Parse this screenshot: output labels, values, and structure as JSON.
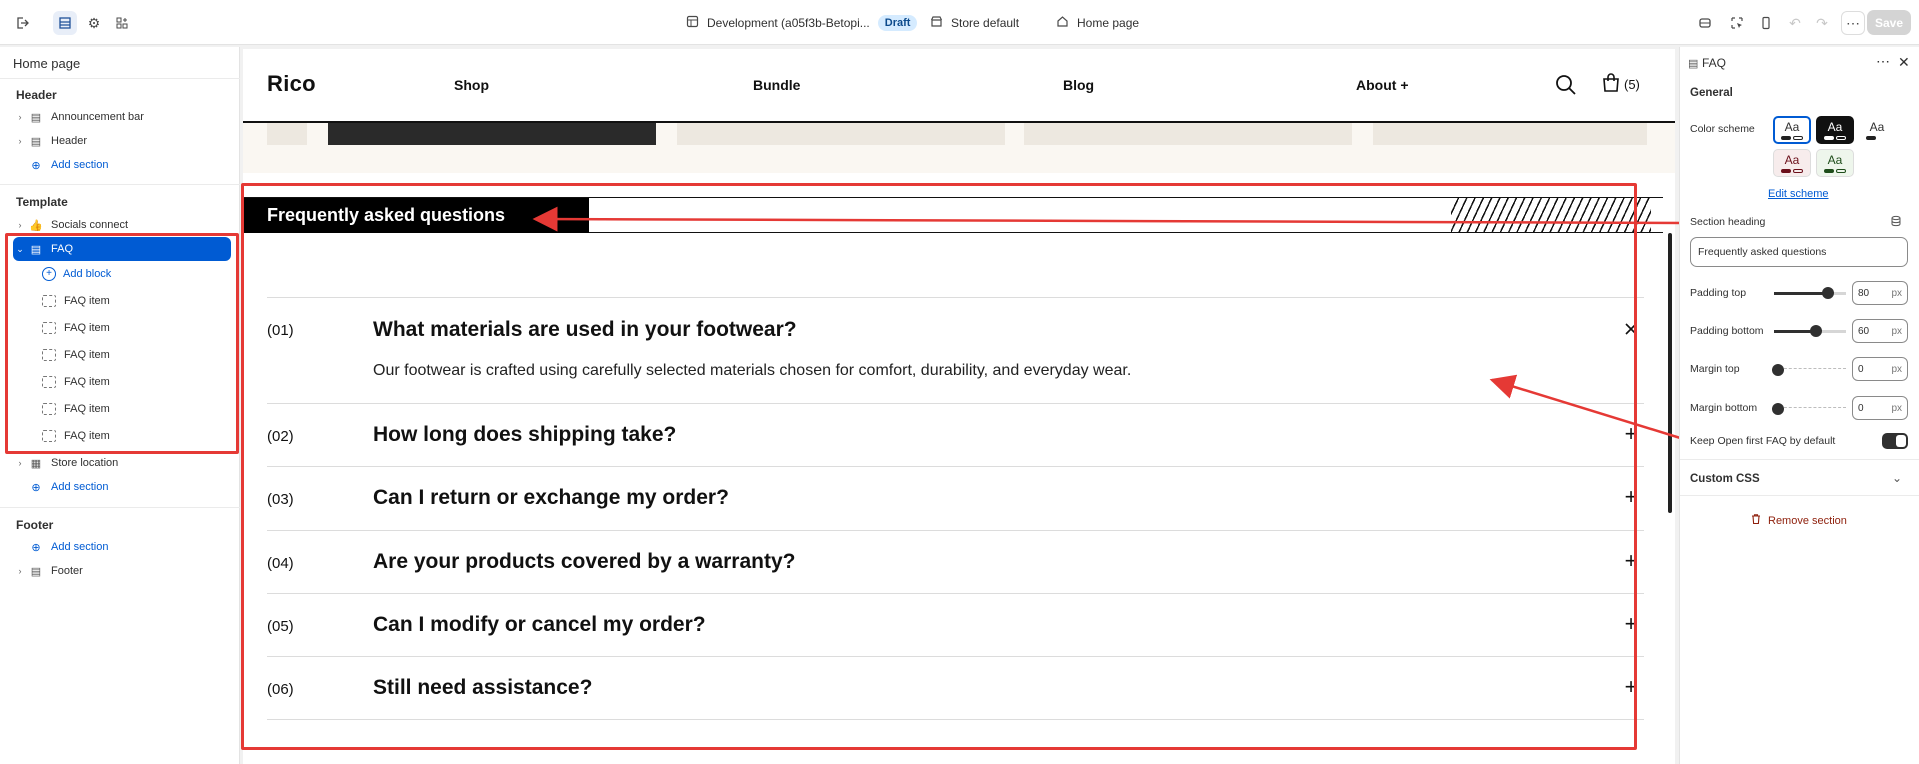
{
  "topbar": {
    "theme_name": "Development (a05f3b-Betopi...",
    "status": "Draft",
    "store": "Store default",
    "page": "Home page",
    "save_label": "Save"
  },
  "left_panel": {
    "title": "Home page",
    "header_group": "Header",
    "header_items": [
      "Announcement bar",
      "Header"
    ],
    "add_section": "Add section",
    "template_group": "Template",
    "socials": "Socials connect",
    "faq": "FAQ",
    "add_block": "Add block",
    "faq_items": [
      "FAQ item",
      "FAQ item",
      "FAQ item",
      "FAQ item",
      "FAQ item",
      "FAQ item"
    ],
    "store_location": "Store location",
    "footer_group": "Footer",
    "footer": "Footer"
  },
  "store": {
    "logo": "Rico",
    "nav": [
      "Shop",
      "Bundle",
      "Blog",
      "About +"
    ],
    "cart_count": "(5)"
  },
  "faq": {
    "heading": "Frequently asked questions",
    "items": [
      {
        "num": "(01)",
        "question": "What materials are used in your footwear?",
        "answer": "Our footwear is crafted using carefully selected materials chosen for comfort, durability, and everyday wear.",
        "open": true
      },
      {
        "num": "(02)",
        "question": "How long does shipping take?",
        "open": false
      },
      {
        "num": "(03)",
        "question": "Can I return or exchange my order?",
        "open": false
      },
      {
        "num": "(04)",
        "question": "Are your products covered by a warranty?",
        "open": false
      },
      {
        "num": "(05)",
        "question": "Can I modify or cancel my order?",
        "open": false
      },
      {
        "num": "(06)",
        "question": "Still need assistance?",
        "open": false
      }
    ]
  },
  "right_panel": {
    "title": "FAQ",
    "general": "General",
    "color_scheme": "Color scheme",
    "swatch_text": "Aa",
    "edit_scheme": "Edit scheme",
    "section_heading_label": "Section heading",
    "section_heading_value": "Frequently asked questions",
    "padding_top": {
      "label": "Padding top",
      "value": "80",
      "unit": "px"
    },
    "padding_bottom": {
      "label": "Padding bottom",
      "value": "60",
      "unit": "px"
    },
    "margin_top": {
      "label": "Margin top",
      "value": "0",
      "unit": "px"
    },
    "margin_bottom": {
      "label": "Margin bottom",
      "value": "0",
      "unit": "px"
    },
    "keep_open_label": "Keep Open first FAQ by default",
    "custom_css": "Custom CSS",
    "remove_section": "Remove section"
  },
  "colors": {
    "accent": "#005bd3",
    "annotation_red": "#e53935"
  }
}
